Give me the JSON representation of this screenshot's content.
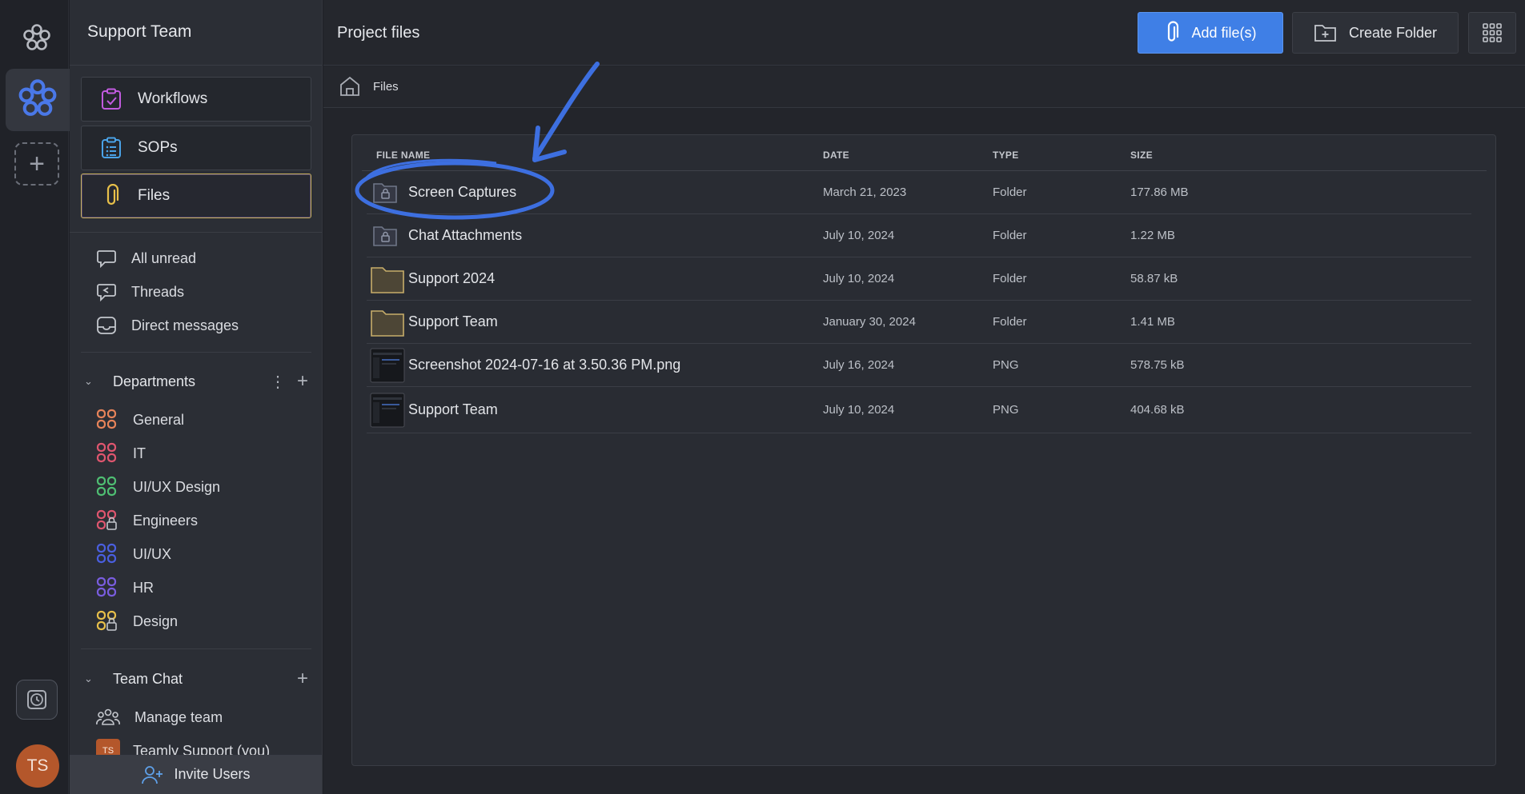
{
  "workspace": {
    "title": "Support Team"
  },
  "rail": {
    "avatar_initials": "TS"
  },
  "nav_cards": [
    {
      "label": "Workflows",
      "icon": "clipboard-check-icon"
    },
    {
      "label": "SOPs",
      "icon": "list-clipboard-icon"
    },
    {
      "label": "Files",
      "icon": "paperclip-icon",
      "active": true
    }
  ],
  "quick_links": [
    {
      "label": "All unread",
      "icon": "chat-bubble-icon"
    },
    {
      "label": "Threads",
      "icon": "threads-icon"
    },
    {
      "label": "Direct messages",
      "icon": "inbox-icon"
    }
  ],
  "departments": {
    "label": "Departments",
    "items": [
      {
        "label": "General",
        "color": "#e8845a"
      },
      {
        "label": "IT",
        "color": "#e0566f"
      },
      {
        "label": "UI/UX Design",
        "color": "#4fbf73"
      },
      {
        "label": "Engineers",
        "color": "#e0566f",
        "locked": true
      },
      {
        "label": "UI/UX",
        "color": "#4a5fe0"
      },
      {
        "label": "HR",
        "color": "#7a5de0"
      },
      {
        "label": "Design",
        "color": "#e8c04a",
        "locked": true
      }
    ]
  },
  "team_chat": {
    "label": "Team Chat",
    "manage_label": "Manage team",
    "member_label": "Teamly Support (you)",
    "member_initials": "TS"
  },
  "invite_label": "Invite Users",
  "main": {
    "title": "Project files",
    "add_files_label": "Add file(s)",
    "create_folder_label": "Create Folder",
    "breadcrumb": "Files"
  },
  "table": {
    "headers": {
      "name": "FILE NAME",
      "date": "DATE",
      "type": "TYPE",
      "size": "SIZE"
    },
    "rows": [
      {
        "name": "Screen Captures",
        "date": "March 21, 2023",
        "type": "Folder",
        "size": "177.86 MB",
        "icon": "locked-folder-icon"
      },
      {
        "name": "Chat Attachments",
        "date": "July 10, 2024",
        "type": "Folder",
        "size": "1.22 MB",
        "icon": "locked-folder-icon"
      },
      {
        "name": "Support 2024",
        "date": "July 10, 2024",
        "type": "Folder",
        "size": "58.87 kB",
        "icon": "folder-icon"
      },
      {
        "name": "Support Team",
        "date": "January 30, 2024",
        "type": "Folder",
        "size": "1.41 MB",
        "icon": "folder-icon"
      },
      {
        "name": "Screenshot 2024-07-16 at 3.50.36 PM.png",
        "date": "July 16, 2024",
        "type": "PNG",
        "size": "578.75 kB",
        "icon": "image-thumbnail-icon"
      },
      {
        "name": "Support Team",
        "date": "July 10, 2024",
        "type": "PNG",
        "size": "404.68 kB",
        "icon": "image-thumbnail-icon"
      }
    ]
  },
  "colors": {
    "accent": "#3f7fe6",
    "annotation": "#3d6fe0",
    "active_border": "#c9b25a",
    "avatar": "#b4572b"
  }
}
